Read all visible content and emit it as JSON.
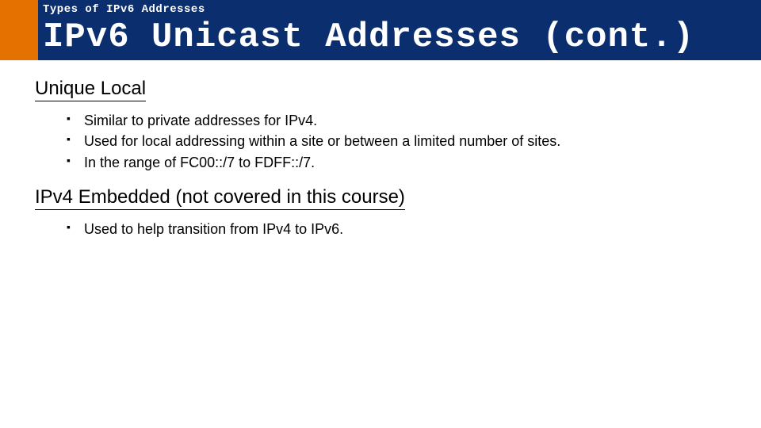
{
  "header": {
    "breadcrumb": "Types of IPv6 Addresses",
    "title": "IPv6 Unicast Addresses (cont.)"
  },
  "sections": [
    {
      "heading": "Unique Local",
      "bullets": [
        "Similar to private addresses for IPv4.",
        "Used for local addressing within a site or between a limited number of sites.",
        "In the range of FC00::/7 to FDFF::/7."
      ]
    },
    {
      "heading": "IPv4 Embedded (not covered in this course)",
      "bullets": [
        "Used to help transition from IPv4 to IPv6."
      ]
    }
  ],
  "colors": {
    "navy": "#0b2e6f",
    "orange": "#e57200"
  }
}
